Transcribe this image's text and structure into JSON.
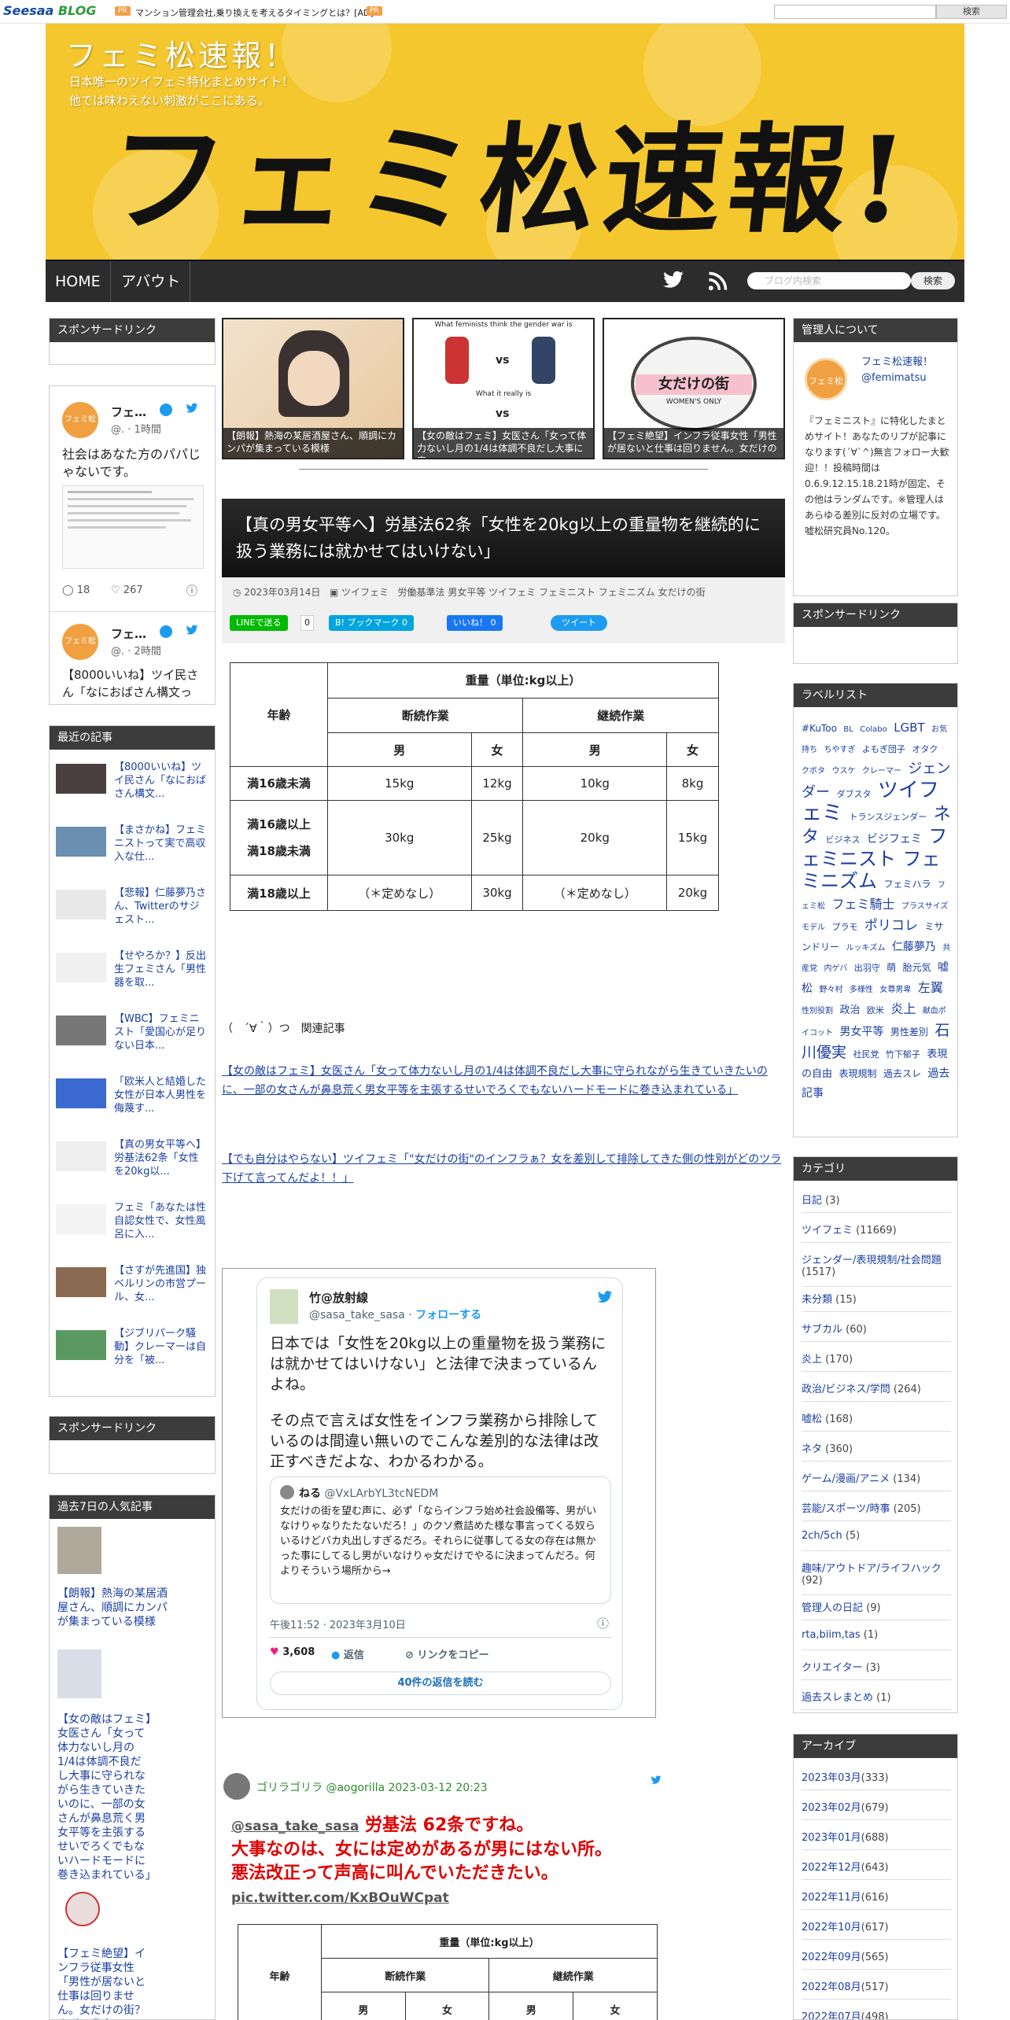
{
  "topbar": {
    "logo": "Seesaa",
    "logo_b": "BLOG",
    "pr1": "PR",
    "ad_text": "マンション管理会社,乗り換えを考えるタイミングとは？[AD]",
    "pr2": "PR",
    "search_button": "検索"
  },
  "header": {
    "title": "フェミ松速報！",
    "subtitle_1": "日本唯一のツイフェミ特化まとめサイト！",
    "subtitle_2": "他では味わえない刺激がここにある。",
    "banner_text": "フェミ松速報!"
  },
  "nav": {
    "home": "HOME",
    "about": "アバウト",
    "search_placeholder": "ブログ内検索",
    "search_button": "検索"
  },
  "left": {
    "sponsor_1": "スポンサードリンク",
    "tweet1_name": "フェ…",
    "tweet1_handle": "@.",
    "tweet1_time": "· 1時間",
    "tweet1_text": "社会はあなた方のパパじゃないです。",
    "tweet1_replies": "18",
    "tweet1_likes": "267",
    "tweet2_name": "フェ…",
    "tweet2_handle": "@.",
    "tweet2_time": "· 2時間",
    "tweet2_text": "【8000いいね】ツイ民さん「なにおばさん構文っ",
    "recent_heading": "最近の記事",
    "recent": [
      "【8000いいね】ツイ民さん「なにおばさん構文...",
      "【まさかね】フェミニストって実で高収入な仕...",
      "【悲報】仁藤夢乃さん、Twitterのサジェスト...",
      "【せやろか？】反出生フェミさん「男性器を取...",
      "【WBC】フェミニスト「愛国心が足りない日本...",
      "「欧米人と結婚した女性が日本人男性を侮蔑す...",
      "【真の男女平等へ】労基法62条「女性を20kg以...",
      "フェミ「あなたは性自認女性で、女性風呂に入...",
      "【さすが先進国】独ベルリンの市営プール、女...",
      "【ジブリパーク騒動】クレーマーは自分を「被..."
    ],
    "sponsor_2": "スポンサードリンク",
    "popular_heading": "過去7日の人気記事",
    "popular": [
      "【朗報】熱海の某居酒屋さん、順調にカンパが集まっている模様",
      "【女の敵はフェミ】女医さん「女って体力ないし月の1/4は体調不良だし大事に守られながら生きていきたいのに、一部の女さんが鼻息荒く男女平等を主張するせいでろくでもないハードモードに巻き込まれている」",
      "【フェミ絶望】インフラ従事女性「男性が居ないと仕事は回りません。女だけの街？まずは貴方(フェ"
    ]
  },
  "featured": [
    "【朗報】熱海の某居酒屋さん、順調にカンパが集まっている模様",
    "【女の敵はフェミ】女医さん「女って体力ないし月の1/4は体調不良だし大事に守",
    "【フェミ絶望】インフラ従事女性「男性が居ないと仕事は回りません。女だけの"
  ],
  "featured_img": {
    "f2_top": "What feminists think the gender war is",
    "f2_mid": "What it really is",
    "vs": "vs",
    "f3_text": "女だけの街",
    "f3_sub": "WOMEN'S ONLY"
  },
  "post": {
    "title": "【真の男女平等へ】労基法62条「女性を20kg以上の重量物を継続的に扱う業務には就かせてはいけない」",
    "date": "2023年03月14日",
    "categories": "ツイフェミ",
    "tags": "労働基準法 男女平等 ツイフェミ フェミニスト フェミニズム 女だけの街",
    "line_btn": "LINEで送る",
    "line_count": "0",
    "hatena_btn": "B! ブックマーク",
    "hatena_count": "0",
    "fb_btn": "いいね！",
    "fb_count": "0",
    "tw_btn": "ツイート"
  },
  "weight_table": {
    "header": "重量（単位:kg以上）",
    "age": "年齢",
    "intermittent": "断続作業",
    "continuous": "継続作業",
    "male": "男",
    "female": "女",
    "rows": [
      {
        "age": "満16歳未満",
        "v": [
          "15kg",
          "12kg",
          "10kg",
          "8kg"
        ]
      },
      {
        "age_1": "満16歳以上",
        "age_2": "満18歳未満",
        "v": [
          "30kg",
          "25kg",
          "20kg",
          "15kg"
        ]
      },
      {
        "age": "満18歳以上",
        "v": [
          "（＊定めなし）",
          "30kg",
          "（＊定めなし）",
          "20kg"
        ]
      }
    ]
  },
  "related": {
    "heading": "（　´∀｀）つ　関連記事",
    "link1": "【女の敵はフェミ】女医さん「女って体力ないし月の1/4は体調不良だし大事に守られながら生きていきたいのに、一部の女さんが鼻息荒く男女平等を主張するせいでろくでもないハードモードに巻き込まれている」",
    "link2": "【でも自分はやらない】ツイフェミ「\"女だけの街\"のインフラぁ？女を差別して排除してきた側の性別がどのツラ下げて言ってんだよ！！」"
  },
  "embed_tweet": {
    "name": "竹@放射線",
    "handle": "@sasa_take_sasa",
    "follow": "フォローする",
    "text_1": "日本では「女性を20kg以上の重量物を扱う業務には就かせてはいけない」と法律で決まっているんよね。",
    "text_2": "その点で言えば女性をインフラ業務から排除しているのは間違い無いのでこんな差別的な法律は改正すべきだよな、わかるわかる。",
    "quote_name": "ねる",
    "quote_handle": "@VxLArbYL3tcNEDM",
    "quote_text": "女だけの街を望む声に、必ず「ならインフラ始め社会設備等、男がいなけりゃなりたたないだろ！」のクソ煮詰めた様な事言ってくる奴らいるけどバカ丸出しすぎるだろ。それらに従事してる女の存在は無かった事にしてるし男がいなけりゃ女だけでやるに決まってんだろ。何よりそういう場所から→",
    "time": "午後11:52 · 2023年3月10日",
    "likes": "3,608",
    "reply": "返信",
    "copy": "リンクをコピー",
    "read": "40件の返信を読む"
  },
  "comment_tweet": {
    "name": "ゴリラゴリラ",
    "handle": "@aogorilla",
    "time": "2023-03-12 20:23",
    "mention": "@sasa_take_sasa",
    "red_1": "労基法 62条ですね。",
    "red_2": "大事なのは、女には定めがあるが男にはない所。",
    "red_3": "悪法改正って声高に叫んでいただきたい。",
    "link": "pic.twitter.com/KxBOuWCpat"
  },
  "right": {
    "admin_heading": "管理人について",
    "admin_name": "フェミ松速報！",
    "admin_handle": "@femimatsu",
    "admin_text": "『フェミニスト』に特化したまとめサイト！あなたのリプが記事になります(´∀`^)無言フォロー大歓迎！！投稿時間は0.6.9.12.15.18.21時が固定、その他はランダムです。※管理人はあらゆる差別に反対の立場です。嘘松研究員No.120。",
    "sponsor": "スポンサードリンク",
    "labels_heading": "ラベルリスト",
    "labels": [
      {
        "t": "#KuToo",
        "s": 12
      },
      {
        "t": "BL",
        "s": 10
      },
      {
        "t": "Colabo",
        "s": 10
      },
      {
        "t": "LGBT",
        "s": 15
      },
      {
        "t": "お気持ち",
        "s": 10
      },
      {
        "t": "ちやすぎ",
        "s": 10
      },
      {
        "t": "よもぎ団子",
        "s": 11
      },
      {
        "t": "オタク",
        "s": 11
      },
      {
        "t": "クボタ",
        "s": 10
      },
      {
        "t": "ウスケ",
        "s": 10
      },
      {
        "t": "クレーマー",
        "s": 10
      },
      {
        "t": "ジェンダー",
        "s": 18
      },
      {
        "t": "ダブスタ",
        "s": 11
      },
      {
        "t": "ツイフェミ",
        "s": 26
      },
      {
        "t": "トランスジェンダー",
        "s": 11
      },
      {
        "t": "ネタ",
        "s": 22
      },
      {
        "t": "ビジネス",
        "s": 11
      },
      {
        "t": "ビジフェミ",
        "s": 14
      },
      {
        "t": "フェミニスト",
        "s": 24
      },
      {
        "t": "フェミニズム",
        "s": 24
      },
      {
        "t": "フェミハラ",
        "s": 12
      },
      {
        "t": "フェミ松",
        "s": 10
      },
      {
        "t": "フェミ騎士",
        "s": 16
      },
      {
        "t": "プラスサイズモデル",
        "s": 10
      },
      {
        "t": "プラモ",
        "s": 11
      },
      {
        "t": "ポリコレ",
        "s": 17
      },
      {
        "t": "ミサンドリー",
        "s": 12
      },
      {
        "t": "ルッキズム",
        "s": 10
      },
      {
        "t": "仁藤夢乃",
        "s": 14
      },
      {
        "t": "共産党",
        "s": 10
      },
      {
        "t": "内ゲバ",
        "s": 10
      },
      {
        "t": "出羽守",
        "s": 11
      },
      {
        "t": "萌",
        "s": 12
      },
      {
        "t": "胎元気",
        "s": 12
      },
      {
        "t": "嘘松",
        "s": 14
      },
      {
        "t": "野々村",
        "s": 10
      },
      {
        "t": "多様性",
        "s": 10
      },
      {
        "t": "女尊男卑",
        "s": 10
      },
      {
        "t": "左翼",
        "s": 16
      },
      {
        "t": "性別役割",
        "s": 10
      },
      {
        "t": "政治",
        "s": 13
      },
      {
        "t": "欧米",
        "s": 11
      },
      {
        "t": "炎上",
        "s": 16
      },
      {
        "t": "献血ポイコット",
        "s": 10
      },
      {
        "t": "男女平等",
        "s": 14
      },
      {
        "t": "男性差別",
        "s": 12
      },
      {
        "t": "石川優実",
        "s": 19
      },
      {
        "t": "社民党",
        "s": 11
      },
      {
        "t": "竹下郁子",
        "s": 11
      },
      {
        "t": "表現の自由",
        "s": 13
      },
      {
        "t": "表現規制",
        "s": 12
      },
      {
        "t": "過去スレ",
        "s": 12
      },
      {
        "t": "過去記事",
        "s": 14
      }
    ],
    "categories_heading": "カテゴリ",
    "categories": [
      {
        "name": "日記",
        "count": "(3)"
      },
      {
        "name": "ツイフェミ",
        "count": "(11669)"
      },
      {
        "name": "ジェンダー/表現規制/社会問題",
        "count": "(1517)"
      },
      {
        "name": "未分類",
        "count": "(15)"
      },
      {
        "name": "サブカル",
        "count": "(60)"
      },
      {
        "name": "炎上",
        "count": "(170)"
      },
      {
        "name": "政治/ビジネス/学問",
        "count": "(264)"
      },
      {
        "name": "嘘松",
        "count": "(168)"
      },
      {
        "name": "ネタ",
        "count": "(360)"
      },
      {
        "name": "ゲーム/漫画/アニメ",
        "count": "(134)"
      },
      {
        "name": "芸能/スポーツ/時事",
        "count": "(205)"
      },
      {
        "name": "2ch/5ch",
        "count": "(5)"
      },
      {
        "name": "趣味/アウトドア/ライフハック",
        "count": "(92)"
      },
      {
        "name": "管理人の日記",
        "count": "(9)"
      },
      {
        "name": "rta,biim,tas",
        "count": "(1)"
      },
      {
        "name": "クリエイター",
        "count": "(3)"
      },
      {
        "name": "過去スレまとめ",
        "count": "(1)"
      }
    ],
    "archive_heading": "アーカイブ",
    "archive": [
      {
        "m": "2023年03月",
        "c": "(333)"
      },
      {
        "m": "2023年02月",
        "c": "(679)"
      },
      {
        "m": "2023年01月",
        "c": "(688)"
      },
      {
        "m": "2022年12月",
        "c": "(643)"
      },
      {
        "m": "2022年11月",
        "c": "(616)"
      },
      {
        "m": "2022年10月",
        "c": "(617)"
      },
      {
        "m": "2022年09月",
        "c": "(565)"
      },
      {
        "m": "2022年08月",
        "c": "(517)"
      },
      {
        "m": "2022年07月",
        "c": "(498)"
      }
    ]
  },
  "colors": {
    "header_yellow": "#f5c72e",
    "sidebar_header": "#3c3c3c",
    "link_blue": "#1a3fa0",
    "comment_red": "#e00000",
    "comment_green": "#2d8a2d"
  }
}
